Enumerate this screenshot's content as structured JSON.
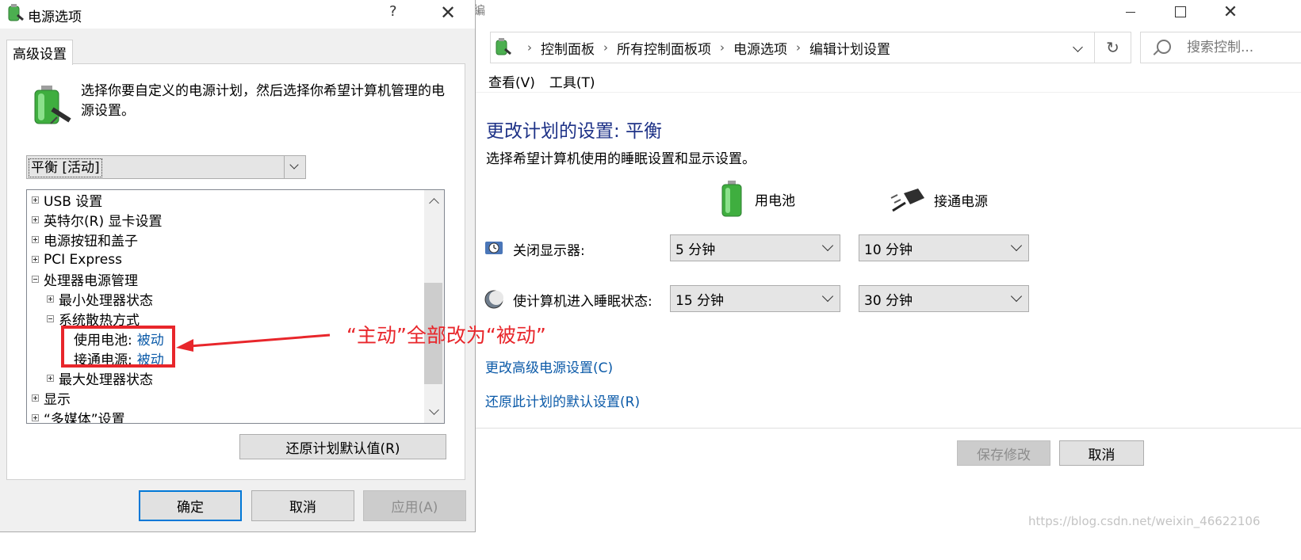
{
  "cp": {
    "breadcrumb": [
      "控制面板",
      "所有控制面板项",
      "电源选项",
      "编辑计划设置"
    ],
    "search_placeholder": "搜索控制...",
    "menu": [
      "查看(V)",
      "工具(T)"
    ],
    "title": "更改计划的设置: 平衡",
    "description": "选择希望计算机使用的睡眠设置和显示设置。",
    "col_battery": "用电池",
    "col_plugged": "接通电源",
    "rows": [
      {
        "label": "关闭显示器:",
        "battery": "5 分钟",
        "plugged": "10 分钟"
      },
      {
        "label": "使计算机进入睡眠状态:",
        "battery": "15 分钟",
        "plugged": "30 分钟"
      }
    ],
    "link_advanced": "更改高级电源设置(C)",
    "link_restore": "还原此计划的默认设置(R)",
    "save_label": "保存修改",
    "cancel_label": "取消",
    "watermark": "https://blog.csdn.net/weixin_46622106",
    "partial_title_char": "編"
  },
  "dialog": {
    "title": "电源选项",
    "help": "?",
    "tab": "高级设置",
    "intro": "选择你要自定义的电源计划，然后选择你希望计算机管理的电源设置。",
    "plan_value": "平衡 [活动]",
    "tree": [
      {
        "label": "USB 设置",
        "level": 0,
        "expander": "plus"
      },
      {
        "label": "英特尔(R) 显卡设置",
        "level": 0,
        "expander": "plus"
      },
      {
        "label": "电源按钮和盖子",
        "level": 0,
        "expander": "plus"
      },
      {
        "label": "PCI Express",
        "level": 0,
        "expander": "plus"
      },
      {
        "label": "处理器电源管理",
        "level": 0,
        "expander": "minus"
      },
      {
        "label": "最小处理器状态",
        "level": 1,
        "expander": "plus"
      },
      {
        "label": "系统散热方式",
        "level": 1,
        "expander": "minus"
      },
      {
        "label": "使用电池:",
        "value": "被动",
        "level": 2,
        "expander": "none"
      },
      {
        "label": "接通电源:",
        "value": "被动",
        "level": 2,
        "expander": "none"
      },
      {
        "label": "最大处理器状态",
        "level": 1,
        "expander": "plus"
      },
      {
        "label": "显示",
        "level": 0,
        "expander": "plus"
      },
      {
        "label": "“多媒体”设置",
        "level": 0,
        "expander": "plus"
      }
    ],
    "restore_defaults": "还原计划默认值(R)",
    "ok": "确定",
    "cancel": "取消",
    "apply": "应用(A)"
  },
  "annotation": "“主动”全部改为“被动”",
  "colors": {
    "annotation": "#e8262b",
    "link": "#0b5aa8",
    "heading": "#1e3287"
  }
}
